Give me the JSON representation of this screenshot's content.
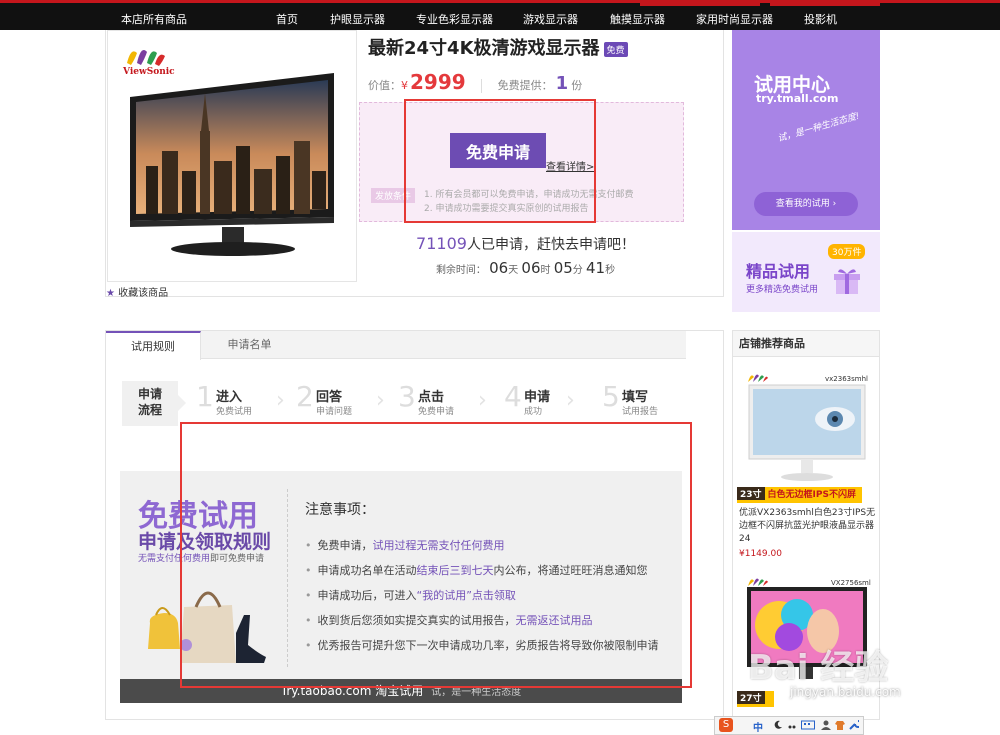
{
  "nav": {
    "items": [
      "本店所有商品",
      "首页",
      "护眼显示器",
      "专业色彩显示器",
      "游戏显示器",
      "触摸显示器",
      "家用时尚显示器",
      "投影机"
    ]
  },
  "product": {
    "brand": "ViewSonic",
    "title": "最新24寸4K极清游戏显示器",
    "free_badge": "免费",
    "price_label": "价值：",
    "currency": "¥",
    "price": "2999",
    "supply_label": "免费提供：",
    "supply_qty": "1",
    "supply_unit": "份",
    "apply_button": "免费申请",
    "detail_link": "查看详情>",
    "notice_tag": "发放条件",
    "notices": [
      "1. 所有会员都可以免费申请，申请成功无需支付邮费",
      "2. 申请成功需要提交真实原创的试用报告"
    ],
    "apply_count": "71109",
    "apply_count_suffix": "人已申请，赶快去申请吧！",
    "time_label": "剩余时间：",
    "time": {
      "days": "06",
      "days_unit": "天",
      "hours": "06",
      "hours_unit": "时",
      "minutes": "05",
      "minutes_unit": "分",
      "seconds": "41",
      "seconds_unit": "秒"
    },
    "favorite": "收藏该商品"
  },
  "promo": {
    "try_title": "试用中心",
    "try_url": "try.tmall.com",
    "try_slogan": "试，是一种生活态度!",
    "my_try_button": "查看我的试用",
    "fine_title": "精品试用",
    "fine_sub": "更多精选免费试用",
    "fine_badge": "30万件"
  },
  "tabs": [
    {
      "label": "试用规则",
      "active": true
    },
    {
      "label": "申请名单",
      "active": false
    }
  ],
  "steps": {
    "first": [
      "申请",
      "流程"
    ],
    "items": [
      {
        "num": "1",
        "title": "进入",
        "sub": "免费试用"
      },
      {
        "num": "2",
        "title": "回答",
        "sub": "申请问题"
      },
      {
        "num": "3",
        "title": "点击",
        "sub": "免费申请"
      },
      {
        "num": "4",
        "title": "申请",
        "sub": "成功"
      },
      {
        "num": "5",
        "title": "填写",
        "sub": "试用报告"
      }
    ]
  },
  "rules": {
    "big_title": "免费试用",
    "sub_title": "申请及领取规则",
    "small_hl": "无需支付任何费用",
    "small_rest": "即可免费申请",
    "heading": "注意事项：",
    "items": [
      {
        "pre": "免费申请，",
        "hl": "试用过程无需支付任何费用",
        "post": ""
      },
      {
        "pre": "申请成功名单在活动",
        "hl": "结束后三到七天",
        "post": "内公布，将通过旺旺消息通知您"
      },
      {
        "pre": "申请成功后，可进入",
        "hl": "“我的试用”点击领取",
        "post": ""
      },
      {
        "pre": "收到货后您须如实提交真实的试用报告，",
        "hl": "无需返还试用品",
        "post": ""
      },
      {
        "pre": "优秀报告可提升您下一次申请成功几率，劣质报告将导致你被限制申请",
        "hl": "",
        "post": ""
      }
    ],
    "footer": "Try.taobao.com 淘宝试用",
    "footer_slogan": "试，是一种生活态度"
  },
  "recommend": {
    "heading": "店铺推荐商品",
    "items": [
      {
        "model": "vx2363smhl",
        "size": "23寸",
        "tag": "白色无边框IPS不闪屏",
        "title": "优派VX2363smhl白色23寸IPS无边框不闪屏抗蓝光护眼液晶显示器24",
        "price": "¥1149.00"
      },
      {
        "model": "VX2756sml",
        "size": "27寸",
        "tag": "",
        "title": "",
        "price": ""
      }
    ]
  },
  "taskbar": {
    "ime": "中"
  },
  "watermark": {
    "text": "Bai 经验",
    "sub": "jingyan.baidu.com"
  },
  "colors": {
    "accent": "#7452b8",
    "price": "#e4393c",
    "nav": "#111111",
    "highlight_frame": "#e53935"
  }
}
